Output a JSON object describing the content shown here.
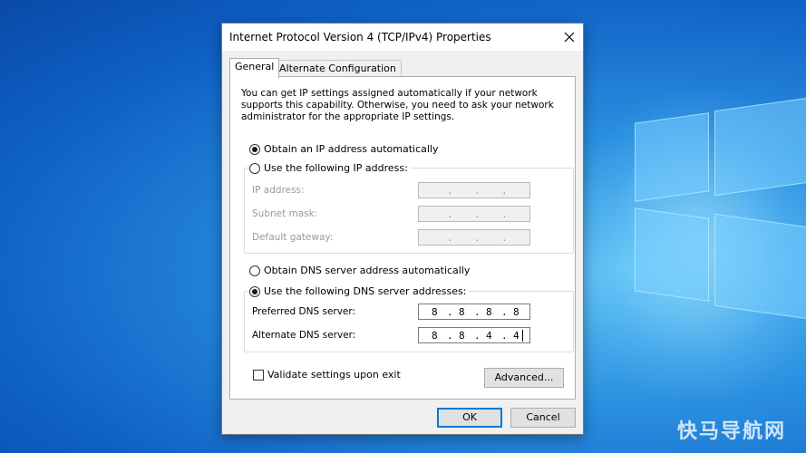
{
  "dialog": {
    "title": "Internet Protocol Version 4 (TCP/IPv4) Properties",
    "tabs": [
      {
        "label": "General",
        "active": true
      },
      {
        "label": "Alternate Configuration",
        "active": false
      }
    ],
    "description": "You can get IP settings assigned automatically if your network supports this capability. Otherwise, you need to ask your network administrator for the appropriate IP settings.",
    "ip": {
      "obtain_auto_label": "Obtain an IP address automatically",
      "obtain_auto_selected": true,
      "use_following_label": "Use the following IP address:",
      "use_following_selected": false,
      "fields": [
        {
          "label": "IP address:",
          "octets": [
            "",
            "",
            "",
            ""
          ],
          "enabled": false
        },
        {
          "label": "Subnet mask:",
          "octets": [
            "",
            "",
            "",
            ""
          ],
          "enabled": false
        },
        {
          "label": "Default gateway:",
          "octets": [
            "",
            "",
            "",
            ""
          ],
          "enabled": false
        }
      ]
    },
    "dns": {
      "obtain_auto_label": "Obtain DNS server address automatically",
      "obtain_auto_selected": false,
      "use_following_label": "Use the following DNS server addresses:",
      "use_following_selected": true,
      "fields": [
        {
          "label": "Preferred DNS server:",
          "octets": [
            "8",
            "8",
            "8",
            "8"
          ],
          "enabled": true
        },
        {
          "label": "Alternate DNS server:",
          "octets": [
            "8",
            "8",
            "4",
            "4"
          ],
          "enabled": true
        }
      ]
    },
    "validate_label": "Validate settings upon exit",
    "validate_checked": false,
    "advanced_label": "Advanced...",
    "ok_label": "OK",
    "cancel_label": "Cancel"
  },
  "watermark": "快马导航网",
  "colors": {
    "accent": "#0078d7",
    "desktop_blue": "#1a73d6",
    "dialog_bg": "#f0f0f0"
  }
}
